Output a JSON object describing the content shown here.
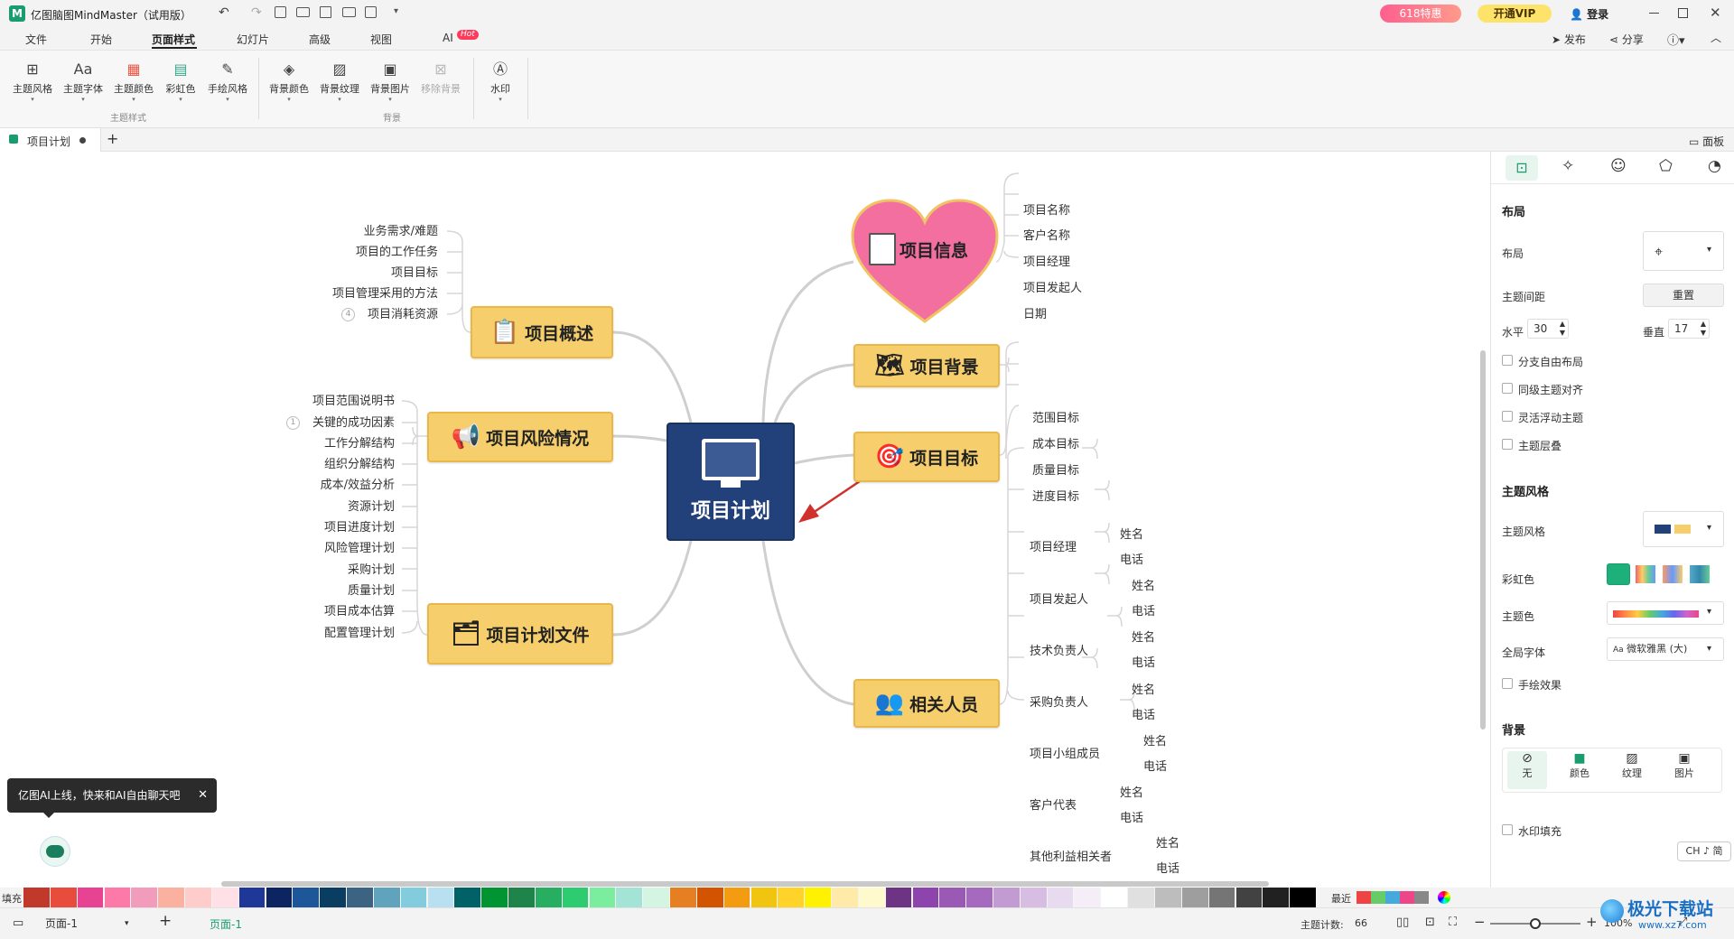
{
  "app": {
    "title": "亿图脑图MindMaster（试用版）",
    "promo": "618特惠",
    "vip": "开通VIP",
    "login": "登录",
    "publish": "发布",
    "share": "分享"
  },
  "menu": {
    "items": [
      "文件",
      "开始",
      "页面样式",
      "幻灯片",
      "高级",
      "视图",
      "AI"
    ],
    "active": "页面样式",
    "hot_badge": "Hot"
  },
  "ribbon": {
    "buttons": [
      {
        "label": "主题风格",
        "icon": "grid-icon",
        "enabled": true
      },
      {
        "label": "主题字体",
        "icon": "font-icon",
        "enabled": true
      },
      {
        "label": "主题颜色",
        "icon": "palette-icon",
        "enabled": true
      },
      {
        "label": "彩虹色",
        "icon": "rainbow-icon",
        "enabled": true
      },
      {
        "label": "手绘风格",
        "icon": "pen-icon",
        "enabled": true
      },
      {
        "label": "背景颜色",
        "icon": "fill-icon",
        "enabled": true
      },
      {
        "label": "背景纹理",
        "icon": "texture-icon",
        "enabled": true
      },
      {
        "label": "背景图片",
        "icon": "image-icon",
        "enabled": true
      },
      {
        "label": "移除背景",
        "icon": "remove-bg-icon",
        "enabled": false
      },
      {
        "label": "水印",
        "icon": "watermark-icon",
        "enabled": true
      }
    ],
    "groups": [
      "主题样式",
      "背景"
    ]
  },
  "doc_tab": {
    "name": "项目计划",
    "panel_toggle": "面板"
  },
  "mindmap": {
    "center": "项目计划",
    "main_topics": [
      {
        "label": "项目信息",
        "icon": "document-icon"
      },
      {
        "label": "项目背景",
        "icon": "map-icon"
      },
      {
        "label": "项目目标",
        "icon": "target-icon"
      },
      {
        "label": "相关人员",
        "icon": "people-icon"
      },
      {
        "label": "项目概述",
        "icon": "checklist-icon"
      },
      {
        "label": "项目风险情况",
        "icon": "megaphone-icon"
      },
      {
        "label": "项目计划文件",
        "icon": "binders-icon"
      }
    ],
    "info_items": [
      "项目名称",
      "客户名称",
      "项目经理",
      "项目发起人",
      "日期"
    ],
    "goal_items": [
      "范围目标",
      "成本目标",
      "质量目标",
      "进度目标"
    ],
    "people_items": [
      {
        "role": "项目经理",
        "subs": [
          "姓名",
          "电话"
        ]
      },
      {
        "role": "项目发起人",
        "subs": [
          "姓名",
          "电话"
        ]
      },
      {
        "role": "技术负责人",
        "subs": [
          "姓名",
          "电话"
        ]
      },
      {
        "role": "采购负责人",
        "subs": [
          "姓名",
          "电话"
        ]
      },
      {
        "role": "项目小组成员",
        "subs": [
          "姓名",
          "电话"
        ]
      },
      {
        "role": "客户代表",
        "subs": [
          "姓名",
          "电话"
        ]
      },
      {
        "role": "其他利益相关者",
        "subs": [
          "姓名",
          "电话"
        ]
      }
    ],
    "overview_items": [
      "业务需求/难题",
      "项目的工作任务",
      "项目目标",
      "项目管理采用的方法",
      "项目消耗资源"
    ],
    "overview_collapsed_count": "4",
    "plan_items": [
      "项目范围说明书",
      "关键的成功因素",
      "工作分解结构",
      "组织分解结构",
      "成本/效益分析",
      "资源计划",
      "项目进度计划",
      "风险管理计划",
      "采购计划",
      "质量计划",
      "项目成本估算",
      "配置管理计划"
    ],
    "plan_collapsed_count": "1"
  },
  "ai_tip": {
    "text": "亿图AI上线，快来和AI自由聊天吧"
  },
  "panel": {
    "tabs": [
      "layout-tab-icon",
      "ai-style-tab-icon",
      "marker-tab-icon",
      "clipart-tab-icon",
      "history-tab-icon"
    ],
    "layout_section": "布局",
    "layout_label": "布局",
    "spacing_label": "主题间距",
    "reset": "重置",
    "h_label": "水平",
    "h_value": "30",
    "v_label": "垂直",
    "v_value": "17",
    "checks": [
      "分支自由布局",
      "同级主题对齐",
      "灵活浮动主题",
      "主题层叠"
    ],
    "style_section": "主题风格",
    "style_label": "主题风格",
    "rainbow_label": "彩虹色",
    "color_label": "主题色",
    "font_label": "全局字体",
    "font_value": "微软雅黑 (大)",
    "handdrawn": "手绘效果",
    "bg_section": "背景",
    "bg_options": [
      "无",
      "颜色",
      "纹理",
      "图片"
    ],
    "watermark_fill": "水印填充",
    "ime": "CH ♪ 简"
  },
  "palette": {
    "fill_label": "填充",
    "recent_label": "最近"
  },
  "status": {
    "page_select": "页面-1",
    "page_tab": "页面-1",
    "topic_count_label": "主题计数:",
    "topic_count": "66",
    "zoom": "100%",
    "zoom_level": 0.5
  },
  "watermark": {
    "text": "极光下载站",
    "url": "www.xz7.com"
  }
}
